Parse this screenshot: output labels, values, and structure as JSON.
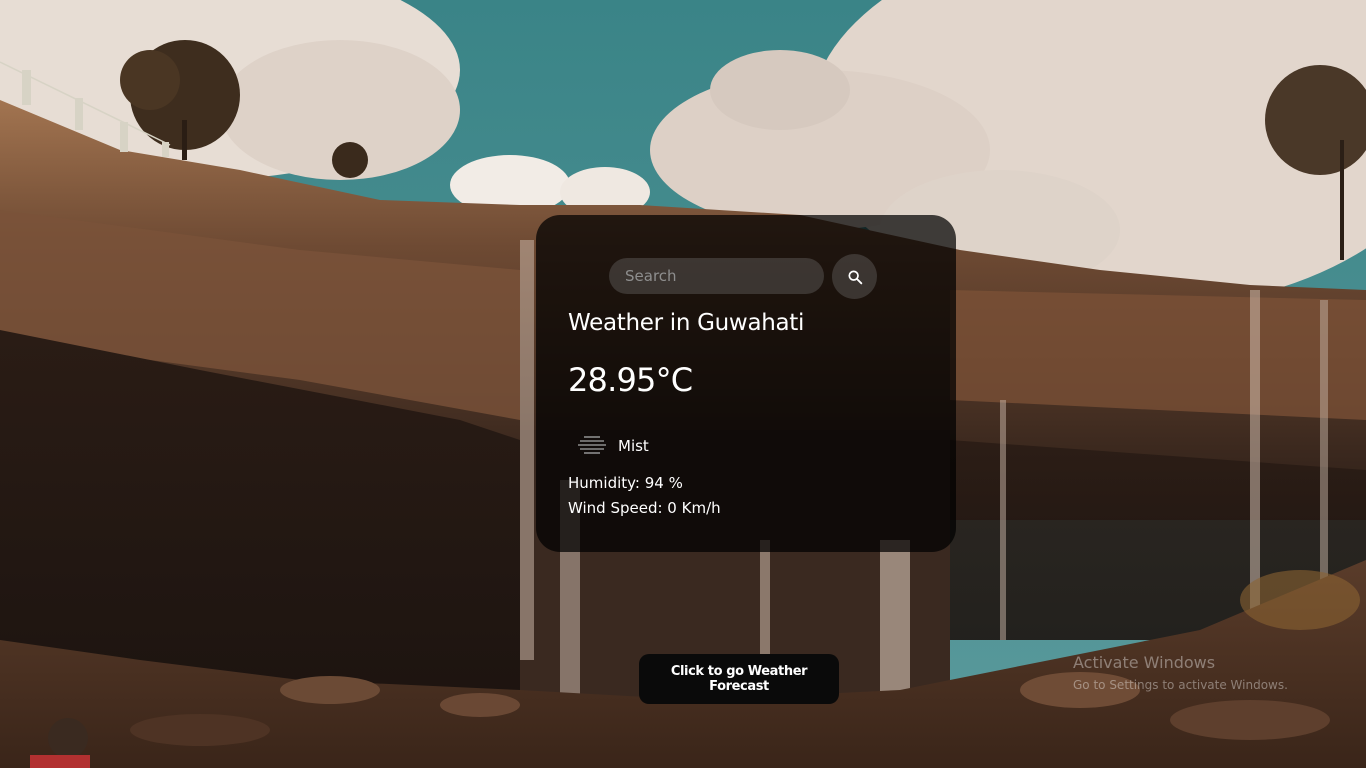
{
  "search": {
    "placeholder": "Search",
    "value": ""
  },
  "weather": {
    "title": "Weather in Guwahati",
    "temperature": "28.95°C",
    "description": "Mist",
    "humidity": "Humidity: 94 %",
    "wind": "Wind Speed: 0 Km/h",
    "icon": "mist-icon"
  },
  "forecast_button": {
    "label": "Click to go Weather Forecast"
  },
  "watermark": {
    "title": "Activate Windows",
    "subtitle": "Go to Settings to activate Windows."
  },
  "icons": {
    "search": "search-icon"
  },
  "colors": {
    "card_background": "#000000b8",
    "text": "#ffffff",
    "input_background": "#7c7c7c54",
    "button_background": "#0a0a0a",
    "sky": "#3e8a8c"
  }
}
